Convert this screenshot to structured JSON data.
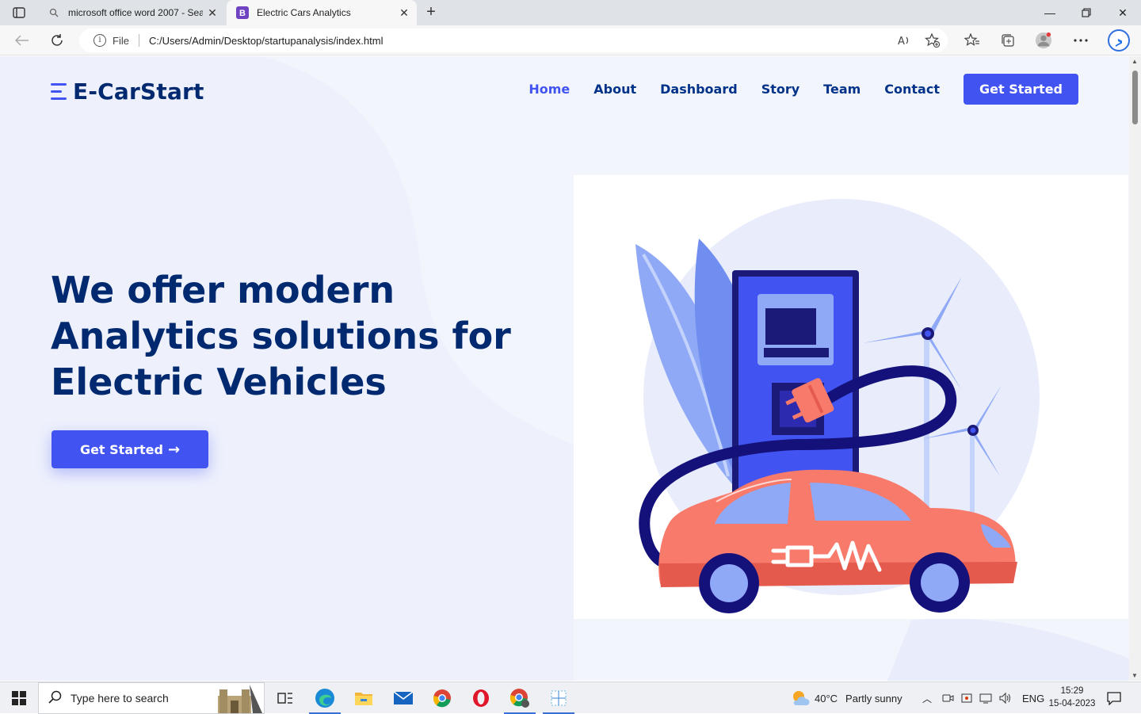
{
  "browser": {
    "tabs": [
      {
        "title": "microsoft office word 2007 - Sea",
        "active": false
      },
      {
        "title": "Electric Cars Analytics",
        "active": true,
        "favicon_letter": "B"
      }
    ],
    "address_prefix": "File",
    "url": "C:/Users/Admin/Desktop/startupanalysis/index.html"
  },
  "site": {
    "logo": "E-CarStart",
    "nav": [
      {
        "label": "Home",
        "active": true
      },
      {
        "label": "About"
      },
      {
        "label": "Dashboard"
      },
      {
        "label": "Story"
      },
      {
        "label": "Team"
      },
      {
        "label": "Contact"
      }
    ],
    "nav_cta": "Get Started",
    "hero_title": "We offer modern Analytics solutions for Electric Vehicles",
    "hero_button": "Get Started",
    "hero_button_arrow": "→",
    "colors": {
      "primary": "#4154f1",
      "heading": "#012970",
      "nav": "#013289",
      "car": "#f87a6b",
      "light": "#e9edfb"
    }
  },
  "taskbar": {
    "search_placeholder": "Type here to search",
    "weather_temp": "40°C",
    "weather_text": "Partly sunny",
    "language": "ENG",
    "time": "15:29",
    "date": "15-04-2023"
  }
}
